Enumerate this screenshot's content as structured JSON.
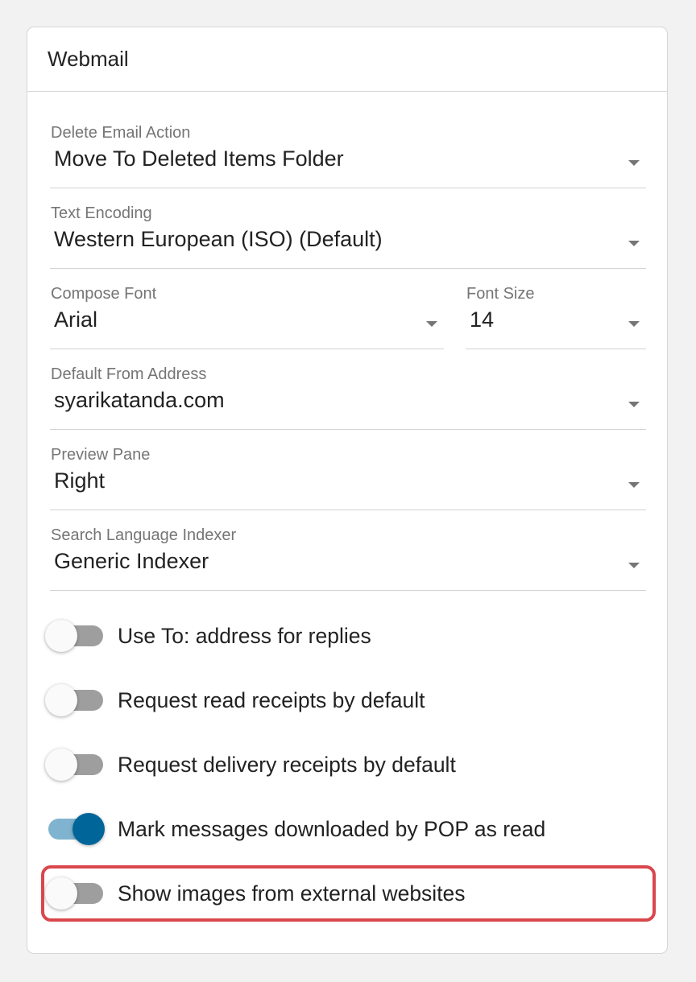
{
  "card": {
    "title": "Webmail"
  },
  "fields": {
    "delete_action": {
      "label": "Delete Email Action",
      "value": "Move To Deleted Items Folder"
    },
    "text_encoding": {
      "label": "Text Encoding",
      "value": "Western European (ISO) (Default)"
    },
    "compose_font": {
      "label": "Compose Font",
      "value": "Arial"
    },
    "font_size": {
      "label": "Font Size",
      "value": "14"
    },
    "default_from": {
      "label": "Default From Address",
      "value": "syarikatanda.com"
    },
    "preview_pane": {
      "label": "Preview Pane",
      "value": "Right"
    },
    "search_indexer": {
      "label": "Search Language Indexer",
      "value": "Generic Indexer"
    }
  },
  "toggles": [
    {
      "label": "Use To: address for replies",
      "checked": false
    },
    {
      "label": "Request read receipts by default",
      "checked": false
    },
    {
      "label": "Request delivery receipts by default",
      "checked": false
    },
    {
      "label": "Mark messages downloaded by POP as read",
      "checked": true
    },
    {
      "label": "Show images from external websites",
      "checked": false
    }
  ],
  "colors": {
    "accent": "#00669a",
    "accent_track": "#7fb3cf",
    "highlight": "#d9474d",
    "switch_off_track": "#9e9e9e"
  },
  "icons": {
    "dropdown": "caret-down-icon"
  }
}
